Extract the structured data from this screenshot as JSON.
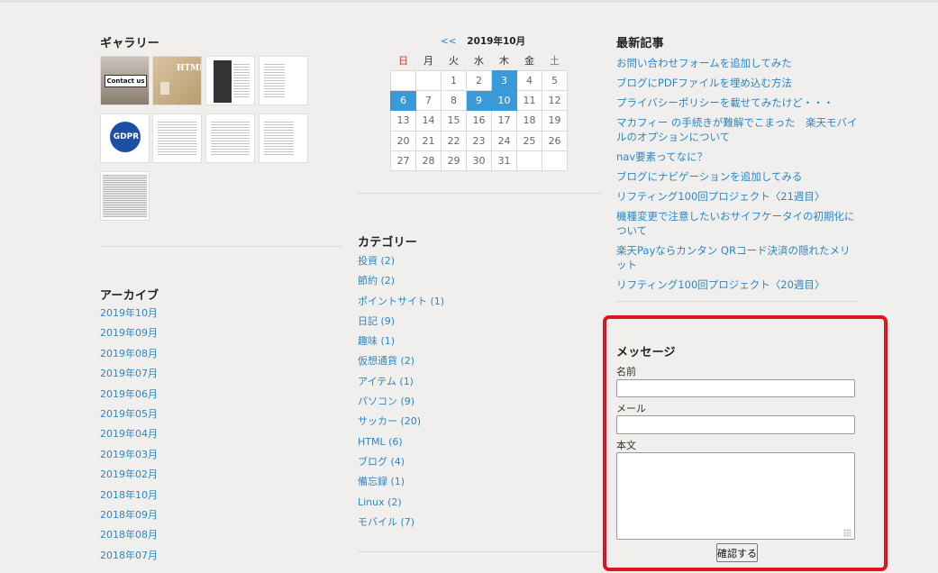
{
  "gallery": {
    "title": "ギャラリー",
    "thumbs": [
      {
        "alt": "Contact us",
        "kind": "photo"
      },
      {
        "alt": "HTML",
        "kind": "photo"
      },
      {
        "kind": "doc"
      },
      {
        "kind": "doc"
      },
      {
        "alt": "GDPR",
        "kind": "logo"
      },
      {
        "kind": "doc"
      },
      {
        "kind": "doc"
      },
      {
        "kind": "doc"
      },
      {
        "kind": "dense"
      }
    ]
  },
  "archive": {
    "title": "アーカイブ",
    "items": [
      "2019年10月",
      "2019年09月",
      "2019年08月",
      "2019年07月",
      "2019年06月",
      "2019年05月",
      "2019年04月",
      "2019年03月",
      "2019年02月",
      "2018年10月",
      "2018年09月",
      "2018年08月",
      "2018年07月"
    ]
  },
  "calendar": {
    "prev": "<<",
    "title": "2019年10月",
    "weekdays": [
      "日",
      "月",
      "火",
      "水",
      "木",
      "金",
      "土"
    ],
    "weeks": [
      [
        "",
        "",
        "1",
        "2",
        "3",
        "4",
        "5"
      ],
      [
        "6",
        "7",
        "8",
        "9",
        "10",
        "11",
        "12"
      ],
      [
        "13",
        "14",
        "15",
        "16",
        "17",
        "18",
        "19"
      ],
      [
        "20",
        "21",
        "22",
        "23",
        "24",
        "25",
        "26"
      ],
      [
        "27",
        "28",
        "29",
        "30",
        "31",
        "",
        ""
      ]
    ],
    "highlighted": [
      "3",
      "6",
      "9",
      "10"
    ]
  },
  "categories": {
    "title": "カテゴリー",
    "items": [
      "投資 (2)",
      "節約 (2)",
      "ポイントサイト (1)",
      "日記 (9)",
      "趣味 (1)",
      "仮想通貨 (2)",
      "アイテム (1)",
      "パソコン (9)",
      "サッカー (20)",
      "HTML (6)",
      "ブログ (4)",
      "備忘録 (1)",
      "Linux (2)",
      "モバイル (7)"
    ]
  },
  "recent": {
    "title": "最新記事",
    "items": [
      "お問い合わせフォームを追加してみた",
      "ブログにPDFファイルを埋め込む方法",
      "プライバシーポリシーを載せてみたけど・・・",
      "マカフィー の手続きが難解でこまった　楽天モバイルのオプションについて",
      "nav要素ってなに？",
      "ブログにナビゲーションを追加してみる",
      "リフティング100回プロジェクト〈21週目〉",
      "機種変更で注意したいおサイフケータイの初期化について",
      "楽天Payならカンタン QRコード決済の隠れたメリット",
      "リフティング100回プロジェクト〈20週目〉"
    ]
  },
  "message_form": {
    "title": "メッセージ",
    "name_label": "名前",
    "email_label": "メール",
    "body_label": "本文",
    "submit_label": "確認する",
    "highlight_color": "#e0141f"
  }
}
